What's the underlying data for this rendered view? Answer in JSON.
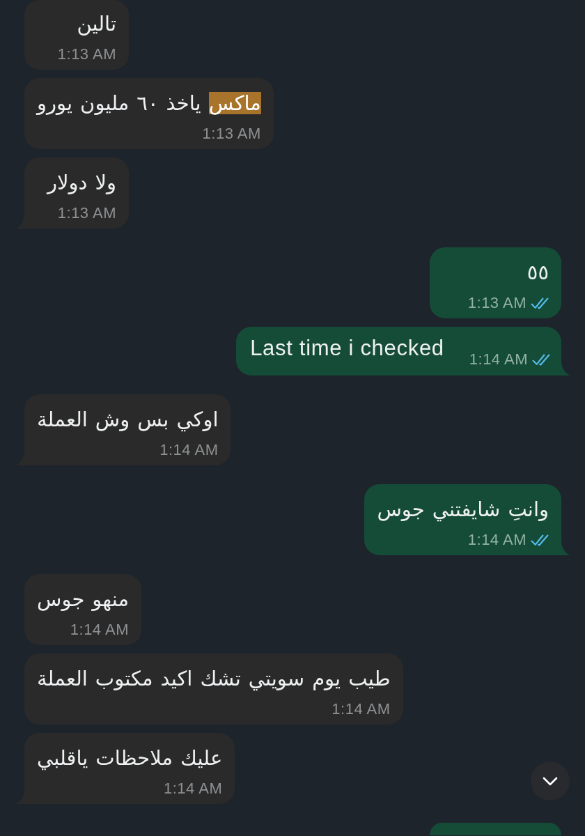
{
  "messages": [
    {
      "outgoing": false,
      "tail": false,
      "cut_off": false,
      "time_inline": false,
      "segments": [
        {
          "text": "تالين",
          "highlighted": false
        }
      ],
      "time": "1:13 AM"
    },
    {
      "outgoing": false,
      "tail": false,
      "cut_off": false,
      "time_inline": false,
      "segments": [
        {
          "text": "ماكس",
          "highlighted": true
        },
        {
          "text": " ياخذ ٦٠ مليون يورو",
          "highlighted": false
        }
      ],
      "time": "1:13 AM"
    },
    {
      "outgoing": false,
      "tail": true,
      "cut_off": false,
      "time_inline": false,
      "segments": [
        {
          "text": "ولا دولار",
          "highlighted": false
        }
      ],
      "time": "1:13 AM"
    },
    {
      "outgoing": true,
      "tail": false,
      "cut_off": false,
      "time_inline": false,
      "segments": [
        {
          "text": "٥٥",
          "highlighted": false
        }
      ],
      "time": "1:13 AM",
      "read": true
    },
    {
      "outgoing": true,
      "tail": true,
      "cut_off": false,
      "time_inline": true,
      "segments": [
        {
          "text": "Last time i checked",
          "highlighted": false
        }
      ],
      "time": "1:14 AM",
      "read": true
    },
    {
      "outgoing": false,
      "tail": true,
      "cut_off": false,
      "time_inline": false,
      "segments": [
        {
          "text": "اوكي بس وش العملة",
          "highlighted": false
        }
      ],
      "time": "1:14 AM"
    },
    {
      "outgoing": true,
      "tail": true,
      "cut_off": false,
      "time_inline": false,
      "segments": [
        {
          "text": "وانتِ شايفتني جوس",
          "highlighted": false
        }
      ],
      "time": "1:14 AM",
      "read": true
    },
    {
      "outgoing": false,
      "tail": false,
      "cut_off": false,
      "time_inline": false,
      "segments": [
        {
          "text": "منهو جوس",
          "highlighted": false
        }
      ],
      "time": "1:14 AM"
    },
    {
      "outgoing": false,
      "tail": false,
      "cut_off": false,
      "time_inline": false,
      "segments": [
        {
          "text": "طيب يوم سويتي تشك اكيد مكتوب العملة",
          "highlighted": false
        }
      ],
      "time": "1:14 AM"
    },
    {
      "outgoing": false,
      "tail": true,
      "cut_off": false,
      "time_inline": false,
      "segments": [
        {
          "text": "عليك ملاحظات ياقلبي",
          "highlighted": false
        }
      ],
      "time": "1:14 AM"
    },
    {
      "outgoing": true,
      "tail": false,
      "cut_off": true
    }
  ]
}
